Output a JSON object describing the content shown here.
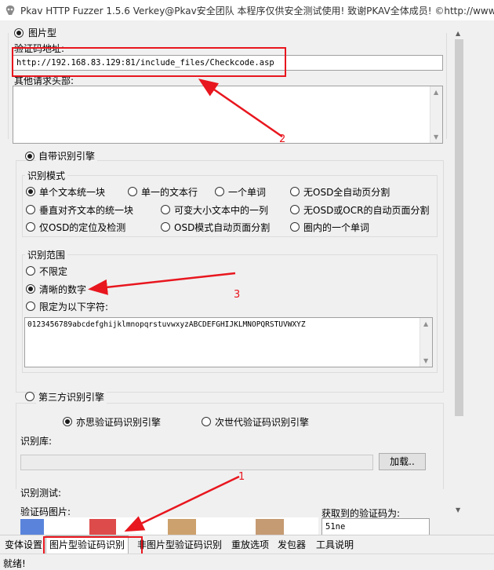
{
  "window": {
    "title": "Pkav HTTP Fuzzer 1.5.6  Verkey@Pkav安全团队  本程序仅供安全测试使用!  致谢PKAV全体成员!  ©http://www"
  },
  "image_type": {
    "radio_label": "图片型",
    "url_label": "验证码地址:",
    "url_value": "http://192.168.83.129:81/include_files/Checkcode.asp",
    "headers_label": "其他请求头部:",
    "headers_value": ""
  },
  "builtin_engine": {
    "radio_label": "自带识别引擎",
    "mode_group": {
      "title": "识别模式",
      "options": [
        "单个文本统一块",
        "单一的文本行",
        "一个单词",
        "无OSD全自动页分割",
        "垂直对齐文本的统一块",
        "可变大小文本中的一列",
        "无OSD或OCR的自动页面分割",
        "仅OSD的定位及检测",
        "OSD模式自动页面分割",
        "圈内的一个单词"
      ],
      "selected": "单个文本统一块"
    },
    "range_group": {
      "title": "识别范围",
      "options": [
        "不限定",
        "清晰的数字",
        "限定为以下字符:"
      ],
      "selected": "清晰的数字",
      "chars_value": "0123456789abcdefghijklmnopqrstuvwxyzABCDEFGHIJKLMNOPQRSTUVWXYZ"
    }
  },
  "third_party_engine": {
    "radio_label": "第三方识别引擎",
    "options": [
      "亦思验证码识别引擎",
      "次世代验证码识别引擎"
    ],
    "selected": "亦思验证码识别引擎",
    "library_label": "识别库:",
    "library_value": "",
    "load_button": "加载.."
  },
  "test": {
    "label": "识别测试:",
    "image_label": "验证码图片:",
    "result_label": "获取到的验证码为:",
    "result_value": "51ne"
  },
  "tabs": [
    "变体设置",
    "图片型验证码识别",
    "非图片型验证码识别",
    "重放选项",
    "发包器",
    "工具说明"
  ],
  "active_tab": "图片型验证码识别",
  "status": "就绪!",
  "annotations": {
    "marker_1": "1",
    "marker_2": "2",
    "marker_3": "3"
  },
  "colors": {
    "annotation_red": "#e8161e",
    "selected_tab": "#ffffff",
    "window_bg": "#f0f0f0"
  }
}
